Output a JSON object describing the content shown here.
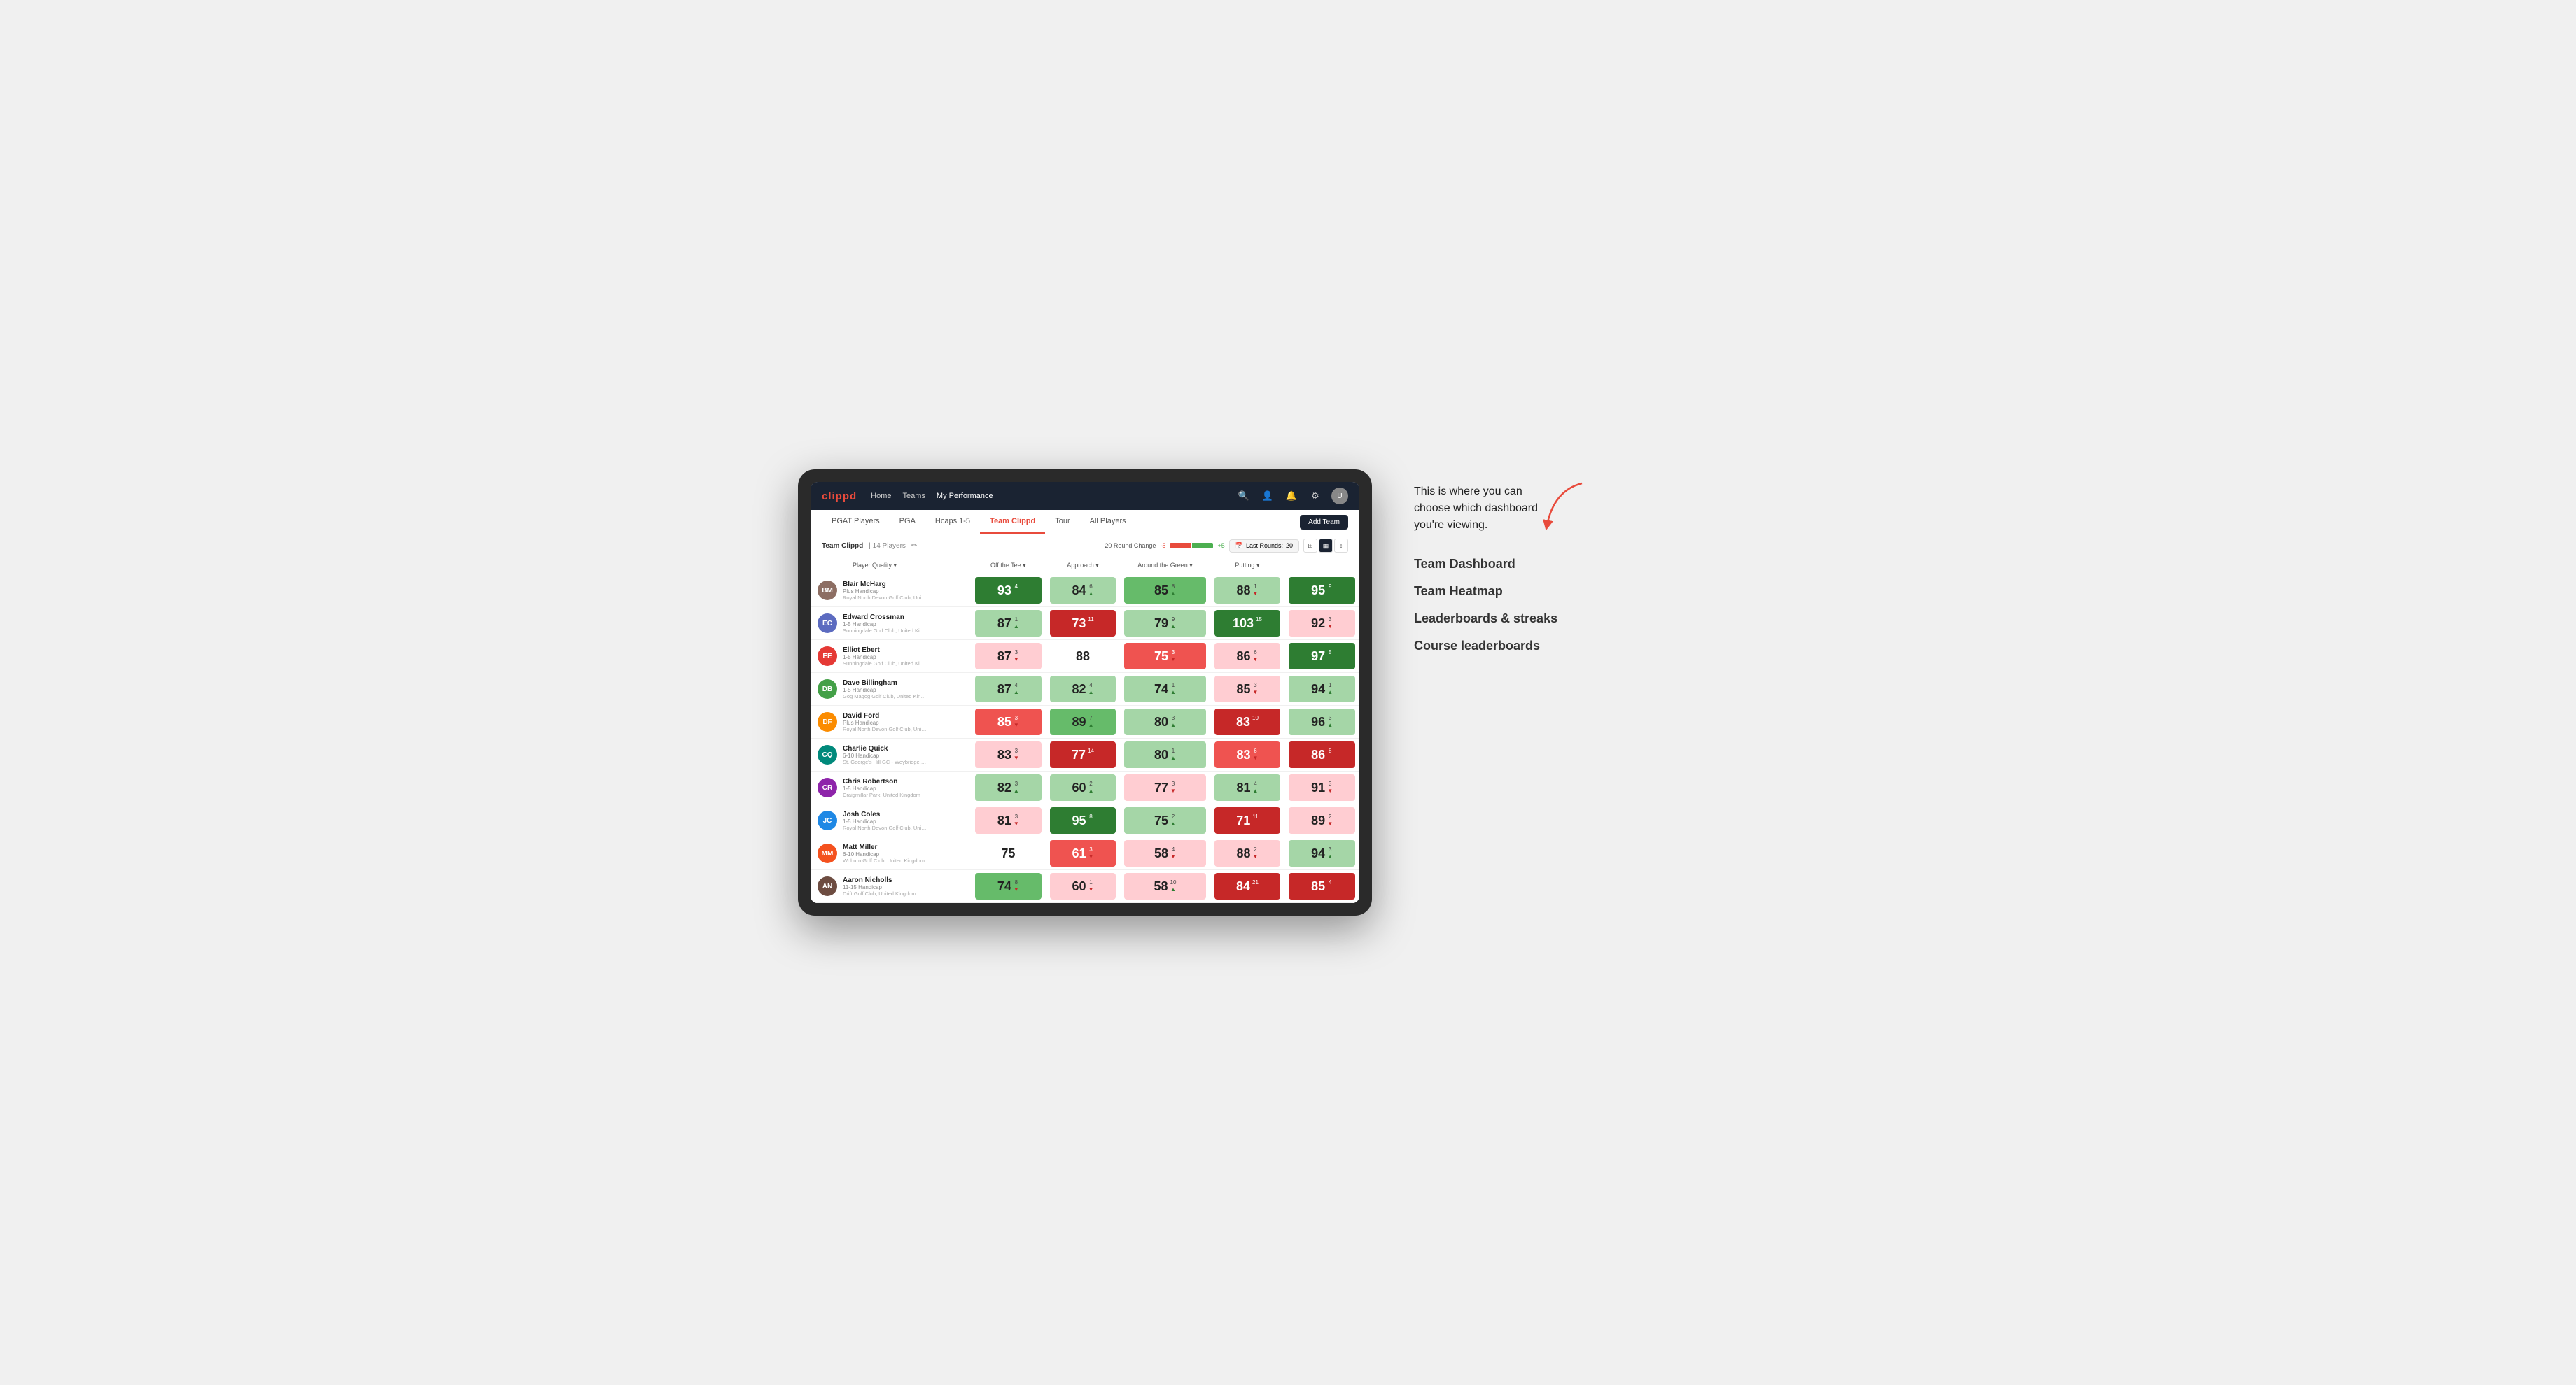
{
  "annotation": {
    "intro_text": "This is where you can choose which dashboard you're viewing.",
    "options": [
      "Team Dashboard",
      "Team Heatmap",
      "Leaderboards & streaks",
      "Course leaderboards"
    ]
  },
  "nav": {
    "logo": "clippd",
    "links": [
      "Home",
      "Teams",
      "My Performance"
    ],
    "active_link": "My Performance"
  },
  "sub_tabs": [
    "PGAT Players",
    "PGA",
    "Hcaps 1-5",
    "Team Clippd",
    "Tour",
    "All Players"
  ],
  "active_sub_tab": "Team Clippd",
  "add_team_label": "Add Team",
  "team_header": {
    "name": "Team Clippd",
    "separator": "|",
    "count": "14 Players",
    "round_change_label": "20 Round Change",
    "change_minus": "-5",
    "change_plus": "+5",
    "last_rounds_label": "Last Rounds:",
    "last_rounds_value": "20"
  },
  "columns": {
    "player": "Player Quality ▾",
    "off_tee": "Off the Tee ▾",
    "approach": "Approach ▾",
    "around_green": "Around the Green ▾",
    "putting": "Putting ▾"
  },
  "players": [
    {
      "name": "Blair McHarg",
      "handicap": "Plus Handicap",
      "club": "Royal North Devon Golf Club, United Kingdom",
      "av_class": "av-1",
      "initials": "BM",
      "scores": [
        {
          "val": "93",
          "change": "4",
          "dir": "up",
          "bg": "bg-green-strong"
        },
        {
          "val": "84",
          "change": "6",
          "dir": "up",
          "bg": "bg-green-light"
        },
        {
          "val": "85",
          "change": "8",
          "dir": "up",
          "bg": "bg-green-mid"
        },
        {
          "val": "88",
          "change": "1",
          "dir": "down",
          "bg": "bg-green-light"
        },
        {
          "val": "95",
          "change": "9",
          "dir": "up",
          "bg": "bg-green-strong"
        }
      ]
    },
    {
      "name": "Edward Crossman",
      "handicap": "1-5 Handicap",
      "club": "Sunningdale Golf Club, United Kingdom",
      "av_class": "av-2",
      "initials": "EC",
      "scores": [
        {
          "val": "87",
          "change": "1",
          "dir": "up",
          "bg": "bg-green-light"
        },
        {
          "val": "73",
          "change": "11",
          "dir": "down",
          "bg": "bg-red-strong"
        },
        {
          "val": "79",
          "change": "9",
          "dir": "up",
          "bg": "bg-green-light"
        },
        {
          "val": "103",
          "change": "15",
          "dir": "up",
          "bg": "bg-green-strong"
        },
        {
          "val": "92",
          "change": "3",
          "dir": "down",
          "bg": "bg-red-light"
        }
      ]
    },
    {
      "name": "Elliot Ebert",
      "handicap": "1-5 Handicap",
      "club": "Sunningdale Golf Club, United Kingdom",
      "av_class": "av-3",
      "initials": "EE",
      "scores": [
        {
          "val": "87",
          "change": "3",
          "dir": "down",
          "bg": "bg-red-light"
        },
        {
          "val": "88",
          "change": "",
          "dir": "",
          "bg": "bg-white"
        },
        {
          "val": "75",
          "change": "3",
          "dir": "down",
          "bg": "bg-red-mid"
        },
        {
          "val": "86",
          "change": "6",
          "dir": "down",
          "bg": "bg-red-light"
        },
        {
          "val": "97",
          "change": "5",
          "dir": "up",
          "bg": "bg-green-strong"
        }
      ]
    },
    {
      "name": "Dave Billingham",
      "handicap": "1-5 Handicap",
      "club": "Gog Magog Golf Club, United Kingdom",
      "av_class": "av-4",
      "initials": "DB",
      "scores": [
        {
          "val": "87",
          "change": "4",
          "dir": "up",
          "bg": "bg-green-light"
        },
        {
          "val": "82",
          "change": "4",
          "dir": "up",
          "bg": "bg-green-light"
        },
        {
          "val": "74",
          "change": "1",
          "dir": "up",
          "bg": "bg-green-light"
        },
        {
          "val": "85",
          "change": "3",
          "dir": "down",
          "bg": "bg-red-light"
        },
        {
          "val": "94",
          "change": "1",
          "dir": "up",
          "bg": "bg-green-light"
        }
      ]
    },
    {
      "name": "David Ford",
      "handicap": "Plus Handicap",
      "club": "Royal North Devon Golf Club, United Kingdom",
      "av_class": "av-5",
      "initials": "DF",
      "scores": [
        {
          "val": "85",
          "change": "3",
          "dir": "down",
          "bg": "bg-red-mid"
        },
        {
          "val": "89",
          "change": "7",
          "dir": "up",
          "bg": "bg-green-mid"
        },
        {
          "val": "80",
          "change": "3",
          "dir": "up",
          "bg": "bg-green-light"
        },
        {
          "val": "83",
          "change": "10",
          "dir": "down",
          "bg": "bg-red-strong"
        },
        {
          "val": "96",
          "change": "3",
          "dir": "up",
          "bg": "bg-green-light"
        }
      ]
    },
    {
      "name": "Charlie Quick",
      "handicap": "6-10 Handicap",
      "club": "St. George's Hill GC - Weybridge, Surrey, Uni...",
      "av_class": "av-6",
      "initials": "CQ",
      "scores": [
        {
          "val": "83",
          "change": "3",
          "dir": "down",
          "bg": "bg-red-light"
        },
        {
          "val": "77",
          "change": "14",
          "dir": "down",
          "bg": "bg-red-strong"
        },
        {
          "val": "80",
          "change": "1",
          "dir": "up",
          "bg": "bg-green-light"
        },
        {
          "val": "83",
          "change": "6",
          "dir": "down",
          "bg": "bg-red-mid"
        },
        {
          "val": "86",
          "change": "8",
          "dir": "down",
          "bg": "bg-red-strong"
        }
      ]
    },
    {
      "name": "Chris Robertson",
      "handicap": "1-5 Handicap",
      "club": "Craigmillar Park, United Kingdom",
      "av_class": "av-7",
      "initials": "CR",
      "scores": [
        {
          "val": "82",
          "change": "3",
          "dir": "up",
          "bg": "bg-green-light"
        },
        {
          "val": "60",
          "change": "2",
          "dir": "up",
          "bg": "bg-green-light"
        },
        {
          "val": "77",
          "change": "3",
          "dir": "down",
          "bg": "bg-red-light"
        },
        {
          "val": "81",
          "change": "4",
          "dir": "up",
          "bg": "bg-green-light"
        },
        {
          "val": "91",
          "change": "3",
          "dir": "down",
          "bg": "bg-red-light"
        }
      ]
    },
    {
      "name": "Josh Coles",
      "handicap": "1-5 Handicap",
      "club": "Royal North Devon Golf Club, United Kingdom",
      "av_class": "av-8",
      "initials": "JC",
      "scores": [
        {
          "val": "81",
          "change": "3",
          "dir": "down",
          "bg": "bg-red-light"
        },
        {
          "val": "95",
          "change": "8",
          "dir": "up",
          "bg": "bg-green-strong"
        },
        {
          "val": "75",
          "change": "2",
          "dir": "up",
          "bg": "bg-green-light"
        },
        {
          "val": "71",
          "change": "11",
          "dir": "down",
          "bg": "bg-red-strong"
        },
        {
          "val": "89",
          "change": "2",
          "dir": "down",
          "bg": "bg-red-light"
        }
      ]
    },
    {
      "name": "Matt Miller",
      "handicap": "6-10 Handicap",
      "club": "Woburn Golf Club, United Kingdom",
      "av_class": "av-9",
      "initials": "MM",
      "scores": [
        {
          "val": "75",
          "change": "",
          "dir": "",
          "bg": "bg-white"
        },
        {
          "val": "61",
          "change": "3",
          "dir": "down",
          "bg": "bg-red-mid"
        },
        {
          "val": "58",
          "change": "4",
          "dir": "down",
          "bg": "bg-red-light"
        },
        {
          "val": "88",
          "change": "2",
          "dir": "down",
          "bg": "bg-red-light"
        },
        {
          "val": "94",
          "change": "3",
          "dir": "up",
          "bg": "bg-green-light"
        }
      ]
    },
    {
      "name": "Aaron Nicholls",
      "handicap": "11-15 Handicap",
      "club": "Drift Golf Club, United Kingdom",
      "av_class": "av-10",
      "initials": "AN",
      "scores": [
        {
          "val": "74",
          "change": "8",
          "dir": "down",
          "bg": "bg-green-mid"
        },
        {
          "val": "60",
          "change": "1",
          "dir": "down",
          "bg": "bg-red-light"
        },
        {
          "val": "58",
          "change": "10",
          "dir": "up",
          "bg": "bg-red-light"
        },
        {
          "val": "84",
          "change": "21",
          "dir": "down",
          "bg": "bg-red-strong"
        },
        {
          "val": "85",
          "change": "4",
          "dir": "down",
          "bg": "bg-red-strong"
        }
      ]
    }
  ]
}
